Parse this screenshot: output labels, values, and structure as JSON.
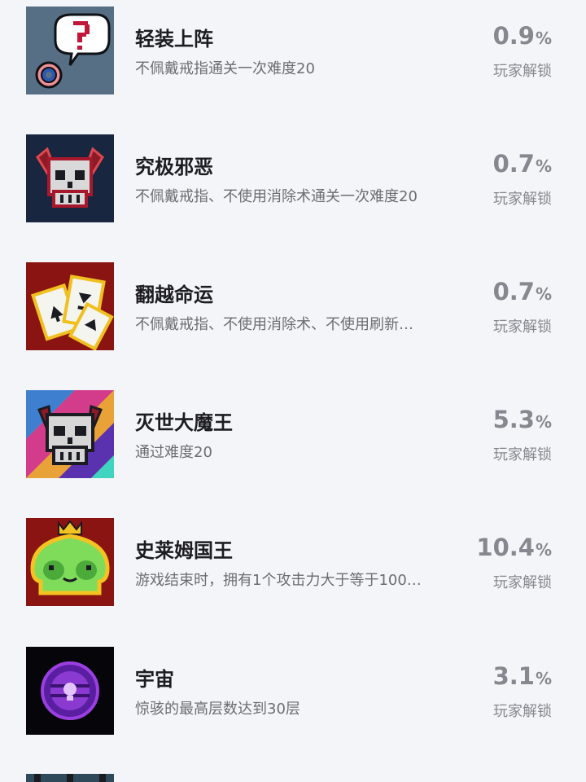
{
  "achievements": [
    {
      "title": "轻装上阵",
      "desc": "不佩戴戒指通关一次难度20",
      "pct": "0.9",
      "pct_sign": "%",
      "unlock": "玩家解锁",
      "icon": "ring-question-icon"
    },
    {
      "title": "究极邪恶",
      "desc": "不佩戴戒指、不使用消除术通关一次难度20",
      "pct": "0.7",
      "pct_sign": "%",
      "unlock": "玩家解锁",
      "icon": "horned-skull-icon"
    },
    {
      "title": "翻越命运",
      "desc": "不佩戴戒指、不使用消除术、不使用刷新…",
      "pct": "0.7",
      "pct_sign": "%",
      "unlock": "玩家解锁",
      "icon": "playing-cards-icon"
    },
    {
      "title": "灭世大魔王",
      "desc": "通过难度20",
      "pct": "5.3",
      "pct_sign": "%",
      "unlock": "玩家解锁",
      "icon": "demon-king-skull-icon"
    },
    {
      "title": "史莱姆国王",
      "desc": "游戏结束时，拥有1个攻击力大于等于100…",
      "pct": "10.4",
      "pct_sign": "%",
      "unlock": "玩家解锁",
      "icon": "slime-king-icon"
    },
    {
      "title": "宇宙",
      "desc": "惊骇的最高层数达到30层",
      "pct": "3.1",
      "pct_sign": "%",
      "unlock": "玩家解锁",
      "icon": "cosmic-orb-icon"
    }
  ]
}
